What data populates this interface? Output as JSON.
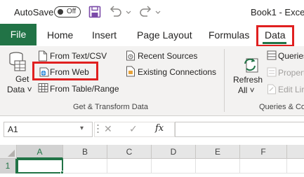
{
  "titlebar": {
    "autosave_label": "AutoSave",
    "autosave_state": "Off",
    "document_title": "Book1 - Exce"
  },
  "tabs": {
    "file": "File",
    "home": "Home",
    "insert": "Insert",
    "page_layout": "Page Layout",
    "formulas": "Formulas",
    "data": "Data"
  },
  "ribbon": {
    "get_data_line1": "Get",
    "get_data_line2": "Data ˅",
    "from_text_csv": "From Text/CSV",
    "from_web": "From Web",
    "from_table_range": "From Table/Range",
    "recent_sources": "Recent Sources",
    "existing_connections": "Existing Connections",
    "group_get_transform": "Get & Transform Data",
    "refresh_line1": "Refresh",
    "refresh_line2": "All ˅",
    "queries": "Queries",
    "properties": "Propert",
    "edit_links": "Edit Lir",
    "group_queries": "Queries & Co"
  },
  "formula_bar": {
    "name_box": "A1",
    "cancel_glyph": "✕",
    "enter_glyph": "✓",
    "fx_glyph": "fx",
    "formula_value": ""
  },
  "grid": {
    "columns": [
      "A",
      "B",
      "C",
      "D",
      "E",
      "F"
    ],
    "rows": [
      "1"
    ],
    "selected_cell": "A1"
  },
  "colors": {
    "excel_green": "#217346",
    "highlight_red": "#e02020",
    "ribbon_bg": "#f3f2f1"
  }
}
